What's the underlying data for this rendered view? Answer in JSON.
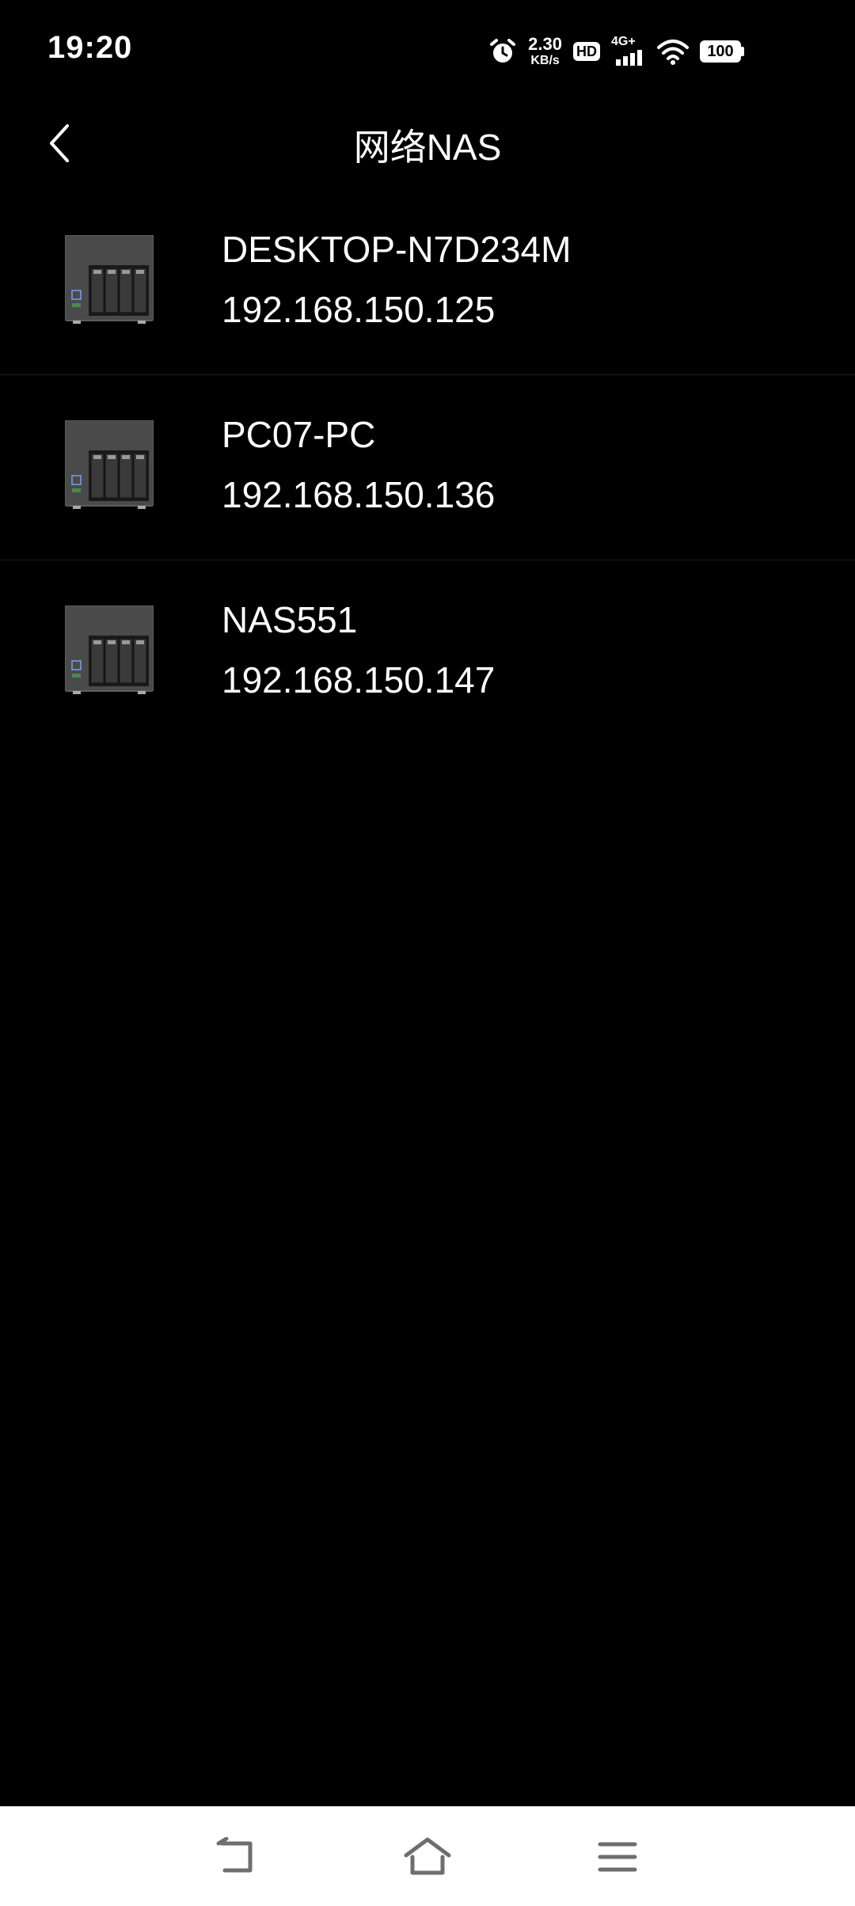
{
  "status_bar": {
    "time": "19:20",
    "net_speed_value": "2.30",
    "net_speed_unit": "KB/s",
    "hd_label": "HD",
    "network_type": "4G+",
    "battery_level": "100"
  },
  "header": {
    "title": "网络NAS"
  },
  "devices": [
    {
      "name": "DESKTOP-N7D234M",
      "ip": "192.168.150.125"
    },
    {
      "name": "PC07-PC",
      "ip": "192.168.150.136"
    },
    {
      "name": "NAS551",
      "ip": "192.168.150.147"
    }
  ],
  "icons": {
    "back": "chevron-left-icon",
    "device": "nas-device-icon",
    "nav_back": "back-icon",
    "nav_home": "home-icon",
    "nav_menu": "menu-icon"
  }
}
